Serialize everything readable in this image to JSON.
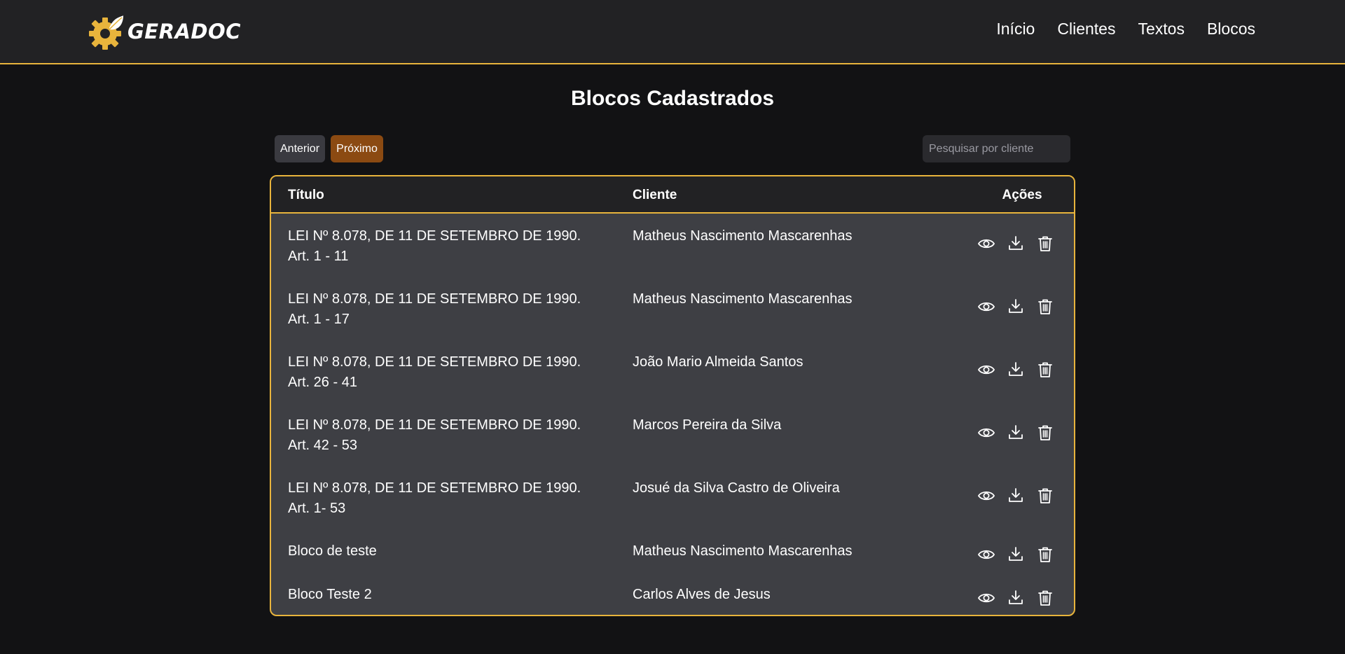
{
  "brand": {
    "name": "GERADOC",
    "accent": "#e8b43c"
  },
  "nav": [
    "Início",
    "Clientes",
    "Textos",
    "Blocos"
  ],
  "page": {
    "title": "Blocos Cadastrados"
  },
  "pagination": {
    "prev_label": "Anterior",
    "next_label": "Próximo"
  },
  "search": {
    "placeholder": "Pesquisar por cliente",
    "value": ""
  },
  "table": {
    "headers": {
      "title": "Título",
      "client": "Cliente",
      "actions": "Ações"
    },
    "rows": [
      {
        "title_line1": "LEI Nº 8.078, DE 11 DE SETEMBRO DE 1990.",
        "title_line2": "Art. 1 - 11",
        "client": "Matheus Nascimento Mascarenhas"
      },
      {
        "title_line1": "LEI Nº 8.078, DE 11 DE SETEMBRO DE 1990.",
        "title_line2": "Art. 1 - 17",
        "client": "Matheus Nascimento Mascarenhas"
      },
      {
        "title_line1": "LEI Nº 8.078, DE 11 DE SETEMBRO DE 1990.",
        "title_line2": "Art. 26 - 41",
        "client": "João Mario Almeida Santos"
      },
      {
        "title_line1": "LEI Nº 8.078, DE 11 DE SETEMBRO DE 1990.",
        "title_line2": "Art. 42 - 53",
        "client": "Marcos Pereira da Silva"
      },
      {
        "title_line1": "LEI Nº 8.078, DE 11 DE SETEMBRO DE 1990.",
        "title_line2": "Art. 1- 53",
        "client": "Josué da Silva Castro de Oliveira"
      },
      {
        "title_line1": "Bloco de teste",
        "title_line2": "",
        "client": "Matheus Nascimento Mascarenhas"
      },
      {
        "title_line1": "Bloco Teste 2",
        "title_line2": "",
        "client": "Carlos Alves de Jesus"
      }
    ],
    "row_actions": [
      "eye-icon",
      "download-icon",
      "trash-icon"
    ]
  }
}
